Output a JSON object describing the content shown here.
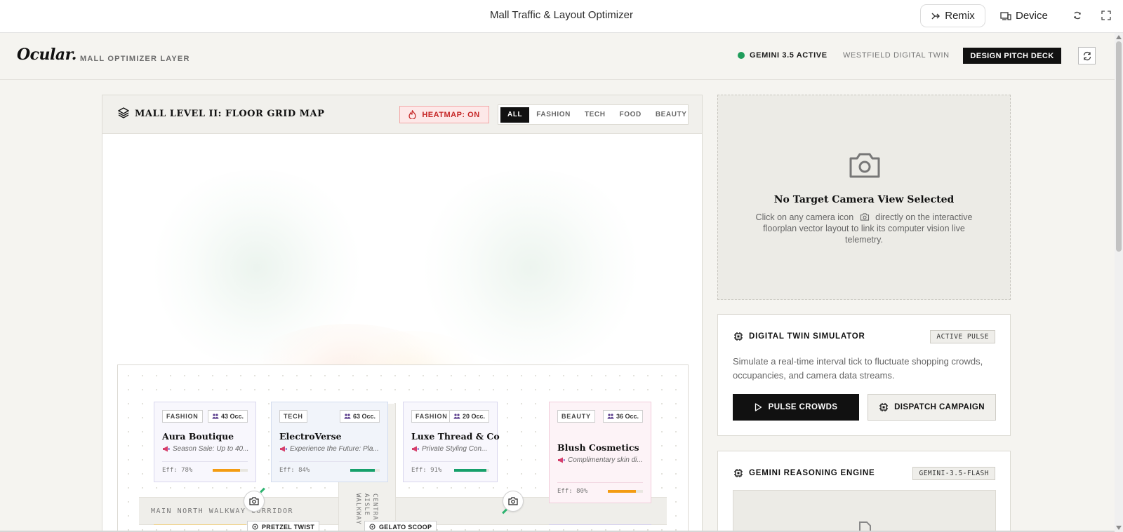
{
  "topbar": {
    "title": "Mall Traffic & Layout Optimizer",
    "remix_label": "Remix",
    "device_label": "Device"
  },
  "app": {
    "logo": "Ocular.",
    "sublogo": "MALL OPTIMIZER LAYER",
    "gemini_status": "GEMINI 3.5 ACTIVE",
    "twin_label": "WESTFIELD DIGITAL TWIN",
    "pitch_button": "DESIGN PITCH DECK",
    "colors": {
      "status_green": "#1f9d5b",
      "accent_dark": "#111111",
      "heat_red": "#c62828"
    }
  },
  "floor": {
    "title": "MALL LEVEL II: FLOOR GRID MAP",
    "heatmap_button": "HEATMAP: ON",
    "filters": [
      {
        "label": "ALL",
        "active": true
      },
      {
        "label": "FASHION",
        "active": false
      },
      {
        "label": "TECH",
        "active": false
      },
      {
        "label": "FOOD",
        "active": false
      },
      {
        "label": "BEAUTY",
        "active": false
      }
    ],
    "corridor_main": "MAIN NORTH WALKWAY CORRIDOR",
    "corridor_central": "CENTRAL AISLE WALKWAY",
    "stores": [
      {
        "category": "FASHION",
        "occupancy": "43 Occ.",
        "name": "Aura Boutique",
        "promo": "Season Sale: Up to 40...",
        "efficiency": "Eff: 78%",
        "eff_value": 0.78,
        "bar_color": "#f39c12"
      },
      {
        "category": "TECH",
        "occupancy": "63 Occ.",
        "name": "ElectroVerse",
        "promo": "Experience the Future: Pla...",
        "efficiency": "Eff: 84%",
        "eff_value": 0.84,
        "bar_color": "#16a06b"
      },
      {
        "category": "FASHION",
        "occupancy": "20 Occ.",
        "name": "Luxe Thread & Co",
        "promo": "Private Styling Con...",
        "efficiency": "Eff: 91%",
        "eff_value": 0.91,
        "bar_color": "#16a06b"
      },
      {
        "category": "BEAUTY",
        "occupancy": "36 Occ.",
        "name": "Blush Cosmetics",
        "promo": "Complimentary skin di...",
        "efficiency": "Eff: 80%",
        "eff_value": 0.8,
        "bar_color": "#f39c12"
      }
    ],
    "food_tags": [
      "PRETZEL TWIST",
      "GELATO SCOOP"
    ]
  },
  "camera_panel": {
    "title": "No Target Camera View Selected",
    "desc_before": "Click on any camera icon",
    "desc_after": "directly on the interactive floorplan vector layout to link its computer vision live telemetry."
  },
  "simulator": {
    "title": "DIGITAL TWIN SIMULATOR",
    "badge": "ACTIVE PULSE",
    "description": "Simulate a real-time interval tick to fluctuate shopping crowds, occupancies, and camera data streams.",
    "pulse_button": "PULSE CROWDS",
    "dispatch_button": "DISPATCH CAMPAIGN"
  },
  "reasoning": {
    "title": "GEMINI REASONING ENGINE",
    "badge": "GEMINI-3.5-FLASH"
  }
}
